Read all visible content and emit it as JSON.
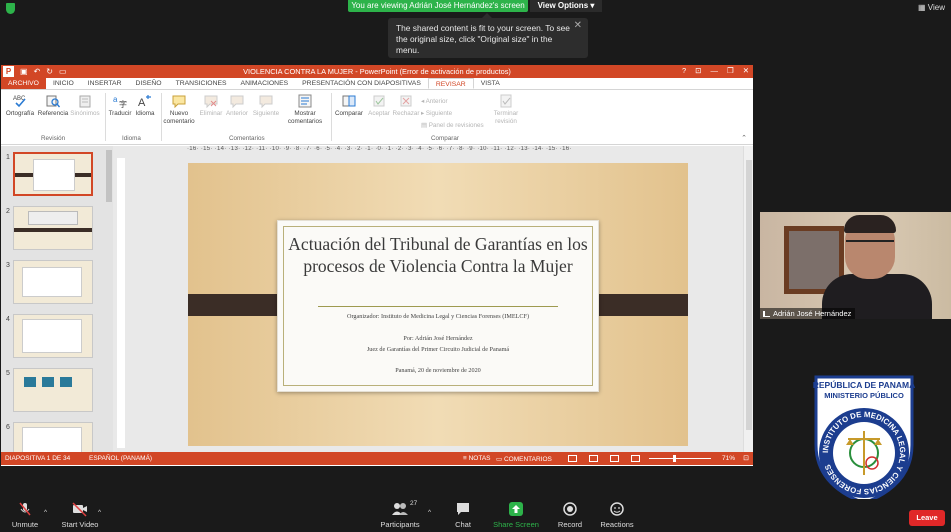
{
  "zoom": {
    "banner": "You are viewing Adrián José Hernández's screen",
    "view_options": "View Options",
    "view": "View",
    "tooltip": "The shared content is fit to your screen. To see the original size, click \"Original size\" in the menu.",
    "bottom": {
      "unmute": "Unmute",
      "start_video": "Start Video",
      "participants": "Participants",
      "participants_count": "27",
      "chat": "Chat",
      "share_screen": "Share Screen",
      "record": "Record",
      "reactions": "Reactions",
      "leave": "Leave"
    },
    "colors": {
      "accent_green": "#2db34a",
      "leave_red": "#e02828"
    }
  },
  "ppt": {
    "title": "VIOLENCIA CONTRA LA MUJER -  PowerPoint (Error de activación de productos)",
    "title_right_icons": [
      "?",
      "⊡",
      "—",
      "❐",
      "✕"
    ],
    "tabs": [
      "ARCHIVO",
      "INICIO",
      "INSERTAR",
      "DISEÑO",
      "TRANSICIONES",
      "ANIMACIONES",
      "PRESENTACIÓN CON DIAPOSITIVAS",
      "REVISAR",
      "VISTA"
    ],
    "active_tab": "REVISAR",
    "ribbon": {
      "ortografia": "Ortografía",
      "referencia": "Referencia",
      "sinonimos": "Sinónimos",
      "traducir": "Traducir",
      "idioma": "Idioma",
      "nuevo_comentario": "Nuevo comentario",
      "eliminar": "Eliminar",
      "anterior": "Anterior",
      "siguiente": "Siguiente",
      "mostrar_comentarios": "Mostrar comentarios",
      "comparar": "Comparar",
      "aceptar": "Aceptar",
      "rechazar": "Rechazar",
      "list_anterior": "Anterior",
      "list_siguiente": "Siguiente",
      "panel_revisiones": "Panel de revisiones",
      "terminar_revision": "Terminar revisión",
      "grp_revision": "Revisión",
      "grp_idioma": "Idioma",
      "grp_comentarios": "Comentarios",
      "grp_comparar": "Comparar"
    },
    "ruler_top": "·16· ·15· ·14· ·13· ·12· ·11· ·10· ·9· ·8· ·7· ·6· ·5· ·4· ·3· ·2· ·1· ·0· ·1· ·2· ·3· ·4· ·5· ·6· ·7· ·8· ·9· ·10· ·11· ·12· ·13· ·14· ·15· ·16·",
    "thumb_numbers": [
      "1",
      "2",
      "3",
      "4",
      "5",
      "6"
    ],
    "slide": {
      "title": "Actuación del Tribunal de Garantías en los procesos de Violencia Contra la Mujer",
      "organizer": "Organizador: Instituto de Medicina Legal y Ciencias Forenses (IMELCF)",
      "by": "Por: Adrián José Hernández",
      "role": "Juez de Garantías del Primer Circuito Judicial de Panamá",
      "date": "Panamá, 20 de noviembre de 2020"
    },
    "status": {
      "slide": "DIAPOSITIVA 1 DE 34",
      "language": "ESPAÑOL (PANAMÁ)",
      "notes": "NOTAS",
      "comments": "COMENTARIOS",
      "zoom": "71%"
    },
    "colors": {
      "accent": "#d24726"
    }
  },
  "webcam": {
    "name": "Adrián José Hernández"
  },
  "seal": {
    "top": "REPÚBLICA DE PANAMÁ",
    "sub": "MINISTERIO PÚBLICO",
    "ring": "INSTITUTO DE MEDICINA LEGAL Y CIENCIAS FORENSES"
  }
}
